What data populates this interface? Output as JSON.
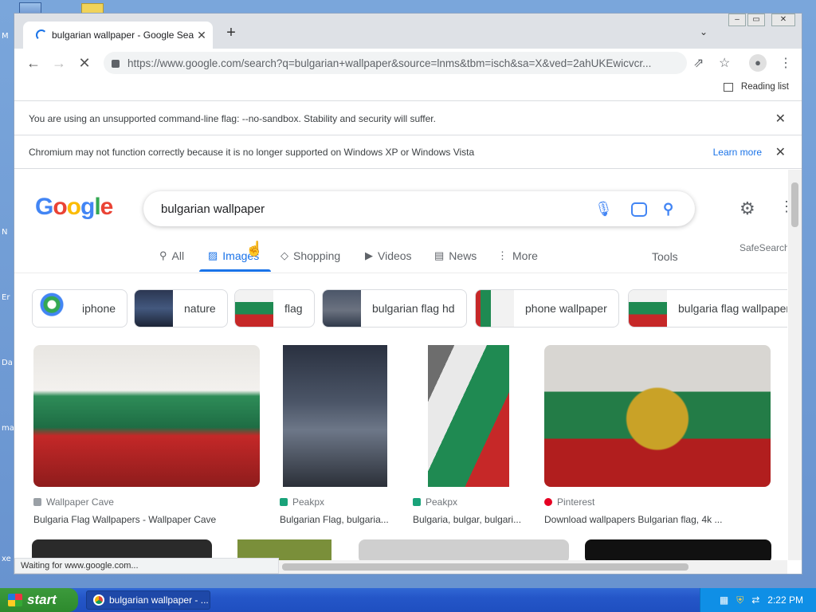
{
  "desktop": {
    "labels": [
      "M",
      "N",
      "Er",
      "Da",
      "ma",
      "xe"
    ]
  },
  "browser": {
    "tab_title": "bulgarian wallpaper - Google Search",
    "tab_close": "✕",
    "new_tab": "+",
    "url": "https://www.google.com/search?q=bulgarian+wallpaper&source=lnms&tbm=isch&sa=X&ved=2ahUKEwicvcr...",
    "reading_list": "Reading list",
    "infobar1": "You are using an unsupported command-line flag: --no-sandbox. Stability and security will suffer.",
    "infobar2": "Chromium may not function correctly because it is no longer supported on Windows XP or Windows Vista",
    "learn_more": "Learn more",
    "status": "Waiting for www.google.com..."
  },
  "google": {
    "logo": "Google",
    "query": "bulgarian wallpaper",
    "tabs": [
      "All",
      "Images",
      "Shopping",
      "Videos",
      "News",
      "More"
    ],
    "tools": "Tools",
    "safesearch": "SafeSearch",
    "chips": [
      "iphone",
      "nature",
      "flag",
      "bulgarian flag hd",
      "phone wallpaper",
      "bulgaria flag wallpaper"
    ],
    "results": [
      {
        "source": "Wallpaper Cave",
        "caption": "Bulgaria Flag Wallpapers - Wallpaper Cave"
      },
      {
        "source": "Peakpx",
        "caption": "Bulgarian Flag, bulgaria..."
      },
      {
        "source": "Peakpx",
        "caption": "Bulgaria, bulgar, bulgari..."
      },
      {
        "source": "Pinterest",
        "caption": "Download wallpapers Bulgarian flag, 4k ..."
      }
    ]
  },
  "taskbar": {
    "start": "start",
    "task": "bulgarian wallpaper - ...",
    "clock": "2:22 PM"
  },
  "colors": {
    "accent": "#1a73e8",
    "flag_white": "#f2f2f2",
    "flag_green": "#1f8a52",
    "flag_red": "#c62828"
  }
}
